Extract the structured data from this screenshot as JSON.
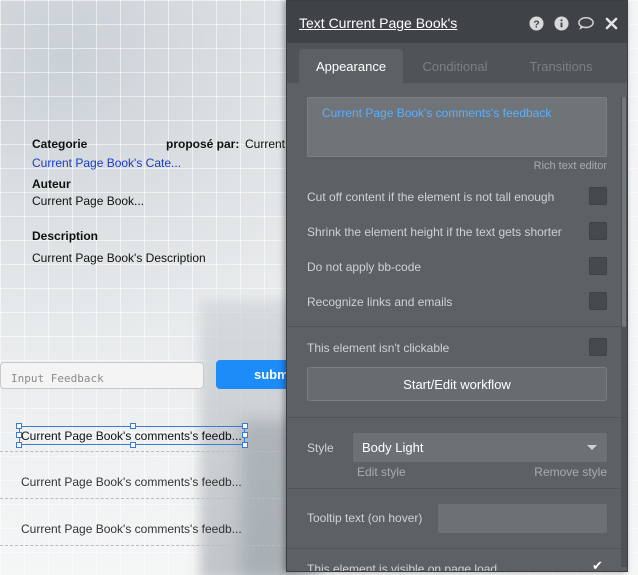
{
  "canvas": {
    "categorie_label": "Categorie",
    "propose_label": "proposé par:",
    "propose_value": "Current",
    "categorie_value": "Current Page Book's Cate...",
    "auteur_label": "Auteur",
    "auteur_value": "Current Page Book...",
    "description_label": "Description",
    "description_value": "Current Page Book's Description",
    "feedback_placeholder": "Input Feedback",
    "submit_label": "subm",
    "comments": [
      "Current Page Book's comments's feedb...",
      "Current Page Book's comments's feedb...",
      "Current Page Book's comments's feedb..."
    ]
  },
  "panel": {
    "title": "Text Current Page Book's",
    "header_icons": [
      "help-icon",
      "info-icon",
      "comment-icon",
      "close-icon"
    ],
    "tabs": [
      "Appearance",
      "Conditional",
      "Transitions"
    ],
    "active_tab": "Appearance",
    "rich_text_content": "Current Page Book's comments's feedback",
    "rich_text_label": "Rich text editor",
    "options": [
      {
        "label": "Cut off content if the element is not tall enough",
        "checked": false
      },
      {
        "label": "Shrink the element height if the text gets shorter",
        "checked": false
      },
      {
        "label": "Do not apply bb-code",
        "checked": false
      },
      {
        "label": "Recognize links and emails",
        "checked": false
      }
    ],
    "not_clickable_label": "This element isn't clickable",
    "not_clickable_checked": false,
    "workflow_button": "Start/Edit workflow",
    "style_label": "Style",
    "style_value": "Body Light",
    "edit_style": "Edit style",
    "remove_style": "Remove style",
    "tooltip_label": "Tooltip text (on hover)",
    "tooltip_value": "",
    "visible_label": "This element is visible on page load",
    "visible_checked": true
  },
  "colors": {
    "accent": "#1d8cf8",
    "link": "#1a3cc8",
    "rich_text": "#5ab0ff",
    "panel_bg": "#5d6165",
    "panel_header": "#3f4246"
  }
}
